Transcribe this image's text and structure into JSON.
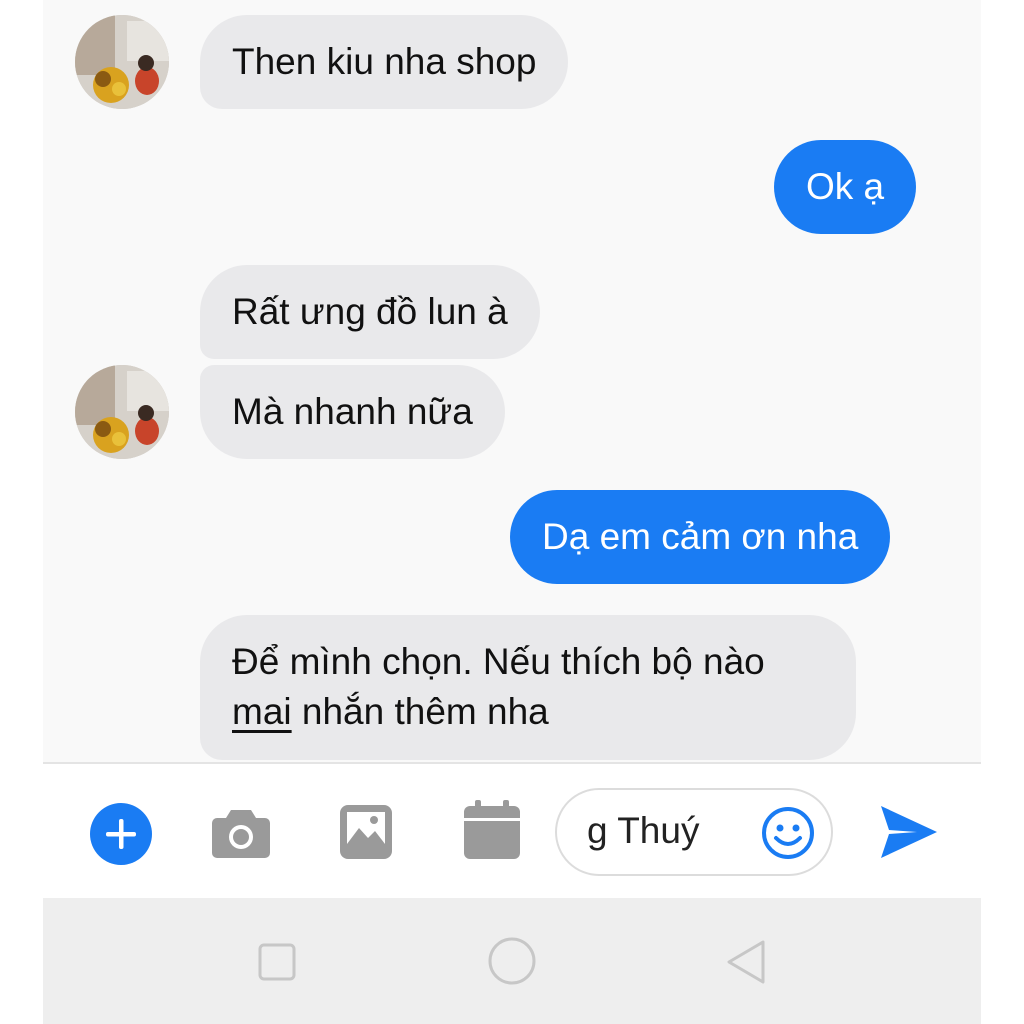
{
  "colors": {
    "accent": "#1a7cf3",
    "incoming_bubble": "#e9e9eb",
    "icon_gray": "#9a9a9a"
  },
  "messages": [
    {
      "from": "contact",
      "text": "Then kiu nha shop"
    },
    {
      "from": "me",
      "text": "Ok ạ"
    },
    {
      "from": "contact",
      "text": "Rất ưng đồ lun à"
    },
    {
      "from": "contact",
      "text": "Mà nhanh nữa"
    },
    {
      "from": "me",
      "text": "Dạ em cảm ơn nha"
    },
    {
      "from": "contact",
      "line1": "Để mình chọn. Nếu thích bộ nào",
      "line2_link": "mai",
      "line2_rest": " nhắn thêm nha"
    }
  ],
  "composer": {
    "input_value": "g Thuý",
    "icons": [
      "plus-icon",
      "camera-icon",
      "gallery-icon",
      "calendar-icon",
      "smiley-icon",
      "send-icon"
    ]
  },
  "navbar": {
    "icons": [
      "recents-icon",
      "home-icon",
      "back-icon"
    ]
  }
}
